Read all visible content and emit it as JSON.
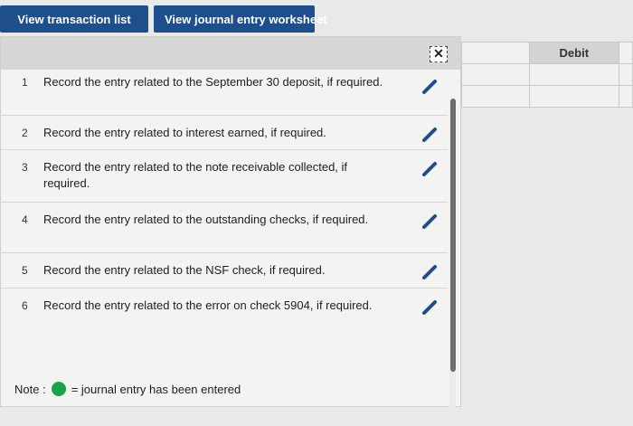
{
  "tabs": {
    "transaction_list": "View transaction list",
    "journal_worksheet": "View journal entry worksheet"
  },
  "panel": {
    "close_symbol": "✕",
    "rows": [
      {
        "num": "1",
        "text": "Record the entry related to the September 30 deposit, if required."
      },
      {
        "num": "2",
        "text": "Record the entry related to interest earned, if required."
      },
      {
        "num": "3",
        "text": "Record the entry related to the note receivable collected, if required."
      },
      {
        "num": "4",
        "text": "Record the entry related to the outstanding checks, if required."
      },
      {
        "num": "5",
        "text": "Record the entry related to the NSF check, if required."
      },
      {
        "num": "6",
        "text": "Record the entry related to the error on check 5904, if required."
      }
    ],
    "note_label": "Note :",
    "note_text": "= journal entry has been entered"
  },
  "grid": {
    "header": "Debit"
  },
  "colors": {
    "tab_bg": "#1f4e8c",
    "pencil": "#1f4e8c",
    "entered_dot": "#16a34a"
  },
  "icons": [
    "pencil-icon",
    "close-icon"
  ]
}
